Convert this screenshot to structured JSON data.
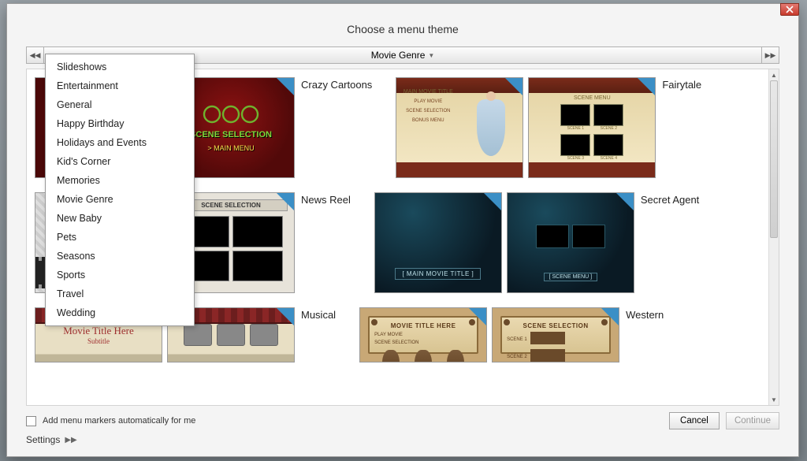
{
  "dialog": {
    "title": "Choose a menu theme"
  },
  "category_bar": {
    "selected": "Movie Genre"
  },
  "dropdown": {
    "items": [
      "Slideshows",
      "Entertainment",
      "General",
      "Happy Birthday",
      "Holidays and Events",
      "Kid's Corner",
      "Memories",
      "Movie Genre",
      "New Baby",
      "Pets",
      "Seasons",
      "Sports",
      "Travel",
      "Wedding"
    ]
  },
  "themes": {
    "row1": [
      {
        "label": "Crazy Cartoons",
        "preview": {
          "scene_label": "SCENE SELECTION",
          "main_menu": "> MAIN MENU"
        }
      },
      {
        "label": "Fairytale",
        "preview": {
          "title": "MAIN MOVIE TITLE",
          "play": "PLAY MOVIE",
          "scenes": "SCENE SELECTION",
          "bonus": "BONUS MENU",
          "scene_menu": "SCENE MENU",
          "s1": "SCENE 1",
          "s2": "SCENE 2",
          "s3": "SCENE 3",
          "s4": "SCENE 4"
        }
      }
    ],
    "row2": [
      {
        "label": "News Reel",
        "preview": {
          "header": "SCENE SELECTION"
        }
      },
      {
        "label": "Secret Agent",
        "preview": {
          "main": "[ MAIN MOVIE TITLE ]",
          "scene": "[ SCENE MENU ]"
        }
      }
    ],
    "row3": [
      {
        "label": "Musical",
        "preview": {
          "title": "Movie Title Here",
          "subtitle": "Subtitle"
        }
      },
      {
        "label": "Western",
        "preview": {
          "title": "MOVIE TITLE HERE",
          "scene": "SCENE SELECTION",
          "play": "PLAY MOVIE",
          "sel": "SCENE SELECTION",
          "s1": "SCENE 1",
          "s2": "SCENE 2"
        }
      }
    ]
  },
  "footer": {
    "checkbox_label": "Add menu markers automatically for me",
    "cancel": "Cancel",
    "continue": "Continue",
    "settings": "Settings"
  }
}
